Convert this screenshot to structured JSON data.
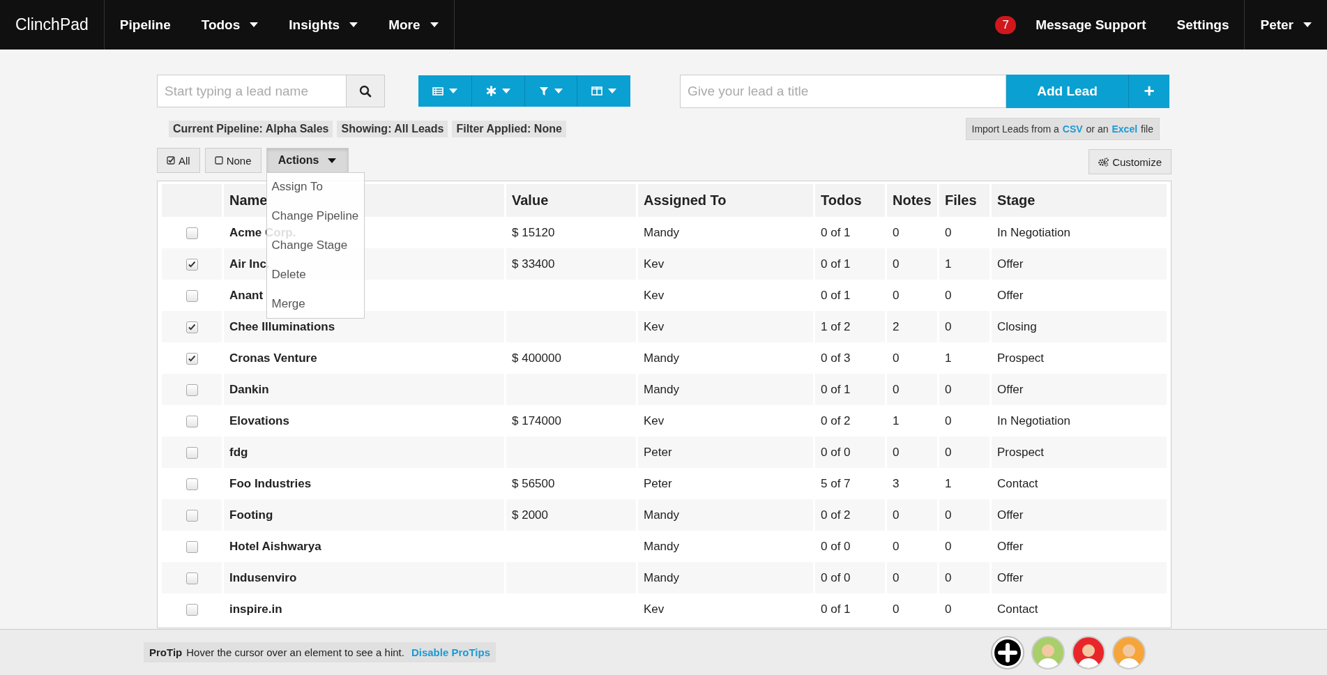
{
  "nav": {
    "brand": "ClinchPad",
    "items": [
      {
        "label": "Pipeline",
        "caret": false
      },
      {
        "label": "Todos",
        "caret": true
      },
      {
        "label": "Insights",
        "caret": true
      },
      {
        "label": "More",
        "caret": true
      }
    ],
    "badge": "7",
    "right_items": [
      {
        "label": "Message Support",
        "caret": false
      },
      {
        "label": "Settings",
        "caret": false
      }
    ],
    "user": {
      "label": "Peter",
      "caret": true
    }
  },
  "search": {
    "placeholder": "Start typing a lead name"
  },
  "view_buttons": [
    {
      "kind": "table"
    },
    {
      "kind": "gear"
    },
    {
      "kind": "filter"
    },
    {
      "kind": "columns"
    }
  ],
  "new_lead": {
    "placeholder": "Give your lead a title",
    "button": "Add Lead",
    "plus": "+"
  },
  "status_tags": [
    "Current Pipeline: Alpha Sales",
    "Showing: All Leads",
    "Filter Applied: None"
  ],
  "import": {
    "prefix": "Import Leads from a",
    "link_1": "CSV",
    "middle": "or an",
    "link_2": "Excel",
    "suffix": "file"
  },
  "select_buttons": [
    {
      "label": "All",
      "kind": "checked"
    },
    {
      "label": "None",
      "kind": "empty"
    }
  ],
  "actions": {
    "label": "Actions",
    "expanded": true,
    "items": [
      "Assign To",
      "Change Pipeline",
      "Change Stage",
      "Delete",
      "Merge"
    ]
  },
  "customize": "Customize",
  "table": {
    "columns": [
      "Name",
      "Value",
      "Assigned To",
      "Todos",
      "Notes",
      "Files",
      "Stage"
    ],
    "rows": [
      {
        "selected": false,
        "cells": [
          "Acme Corp.",
          "$ 15120",
          "Mandy",
          "0 of 1",
          "0",
          "0",
          "In Negotiation"
        ]
      },
      {
        "selected": true,
        "cells": [
          "Air Inc.",
          "$ 33400",
          "Kev",
          "0 of 1",
          "0",
          "1",
          "Offer"
        ]
      },
      {
        "selected": false,
        "cells": [
          "Anant",
          "",
          "Kev",
          "0 of 1",
          "0",
          "0",
          "Offer"
        ]
      },
      {
        "selected": true,
        "cells": [
          "Chee Illuminations",
          "",
          "Kev",
          "1 of 2",
          "2",
          "0",
          "Closing"
        ]
      },
      {
        "selected": true,
        "cells": [
          "Cronas Venture",
          "$ 400000",
          "Mandy",
          "0 of 3",
          "0",
          "1",
          "Prospect"
        ]
      },
      {
        "selected": false,
        "cells": [
          "Dankin",
          "",
          "Mandy",
          "0 of 1",
          "0",
          "0",
          "Offer"
        ]
      },
      {
        "selected": false,
        "cells": [
          "Elovations",
          "$ 174000",
          "Kev",
          "0 of 2",
          "1",
          "0",
          "In Negotiation"
        ]
      },
      {
        "selected": false,
        "cells": [
          "fdg",
          "",
          "Peter",
          "0 of 0",
          "0",
          "0",
          "Prospect"
        ]
      },
      {
        "selected": false,
        "cells": [
          "Foo Industries",
          "$ 56500",
          "Peter",
          "5 of 7",
          "3",
          "1",
          "Contact"
        ]
      },
      {
        "selected": false,
        "cells": [
          "Footing",
          "$ 2000",
          "Mandy",
          "0 of 2",
          "0",
          "0",
          "Offer"
        ]
      },
      {
        "selected": false,
        "cells": [
          "Hotel Aishwarya",
          "",
          "Mandy",
          "0 of 0",
          "0",
          "0",
          "Offer"
        ]
      },
      {
        "selected": false,
        "cells": [
          "Indusenviro",
          "",
          "Mandy",
          "0 of 0",
          "0",
          "0",
          "Offer"
        ]
      },
      {
        "selected": false,
        "cells": [
          "inspire.in",
          "",
          "Kev",
          "0 of 1",
          "0",
          "0",
          "Contact"
        ]
      }
    ]
  },
  "protip": {
    "label": "ProTip",
    "text": "Hover the cursor over an element to see a hint.",
    "link": "Disable ProTips"
  },
  "avatars": [
    {
      "color": "#a9cf6a"
    },
    {
      "color": "#e8262a"
    },
    {
      "color": "#f5a53a"
    }
  ]
}
